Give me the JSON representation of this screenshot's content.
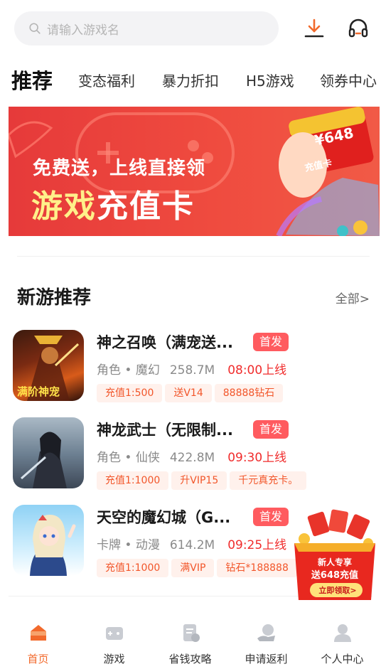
{
  "search": {
    "placeholder": "请输入游戏名",
    "icon": "search-icon"
  },
  "header_icons": {
    "download": "download-icon",
    "service": "headset-icon"
  },
  "tabs": [
    {
      "label": "推荐",
      "active": true
    },
    {
      "label": "变态福利"
    },
    {
      "label": "暴力折扣"
    },
    {
      "label": "H5游戏"
    },
    {
      "label": "领券中心"
    }
  ],
  "banner": {
    "line1": "免费送，上线直接领",
    "line2_a": "游戏",
    "line2_b": "充值卡",
    "card_amount": "¥648",
    "card_text": "充值卡"
  },
  "section": {
    "title": "新游推荐",
    "more": "全部>"
  },
  "games": [
    {
      "name": "神之召唤（满宠送...",
      "badge": "首发",
      "category": "角色 • 魔幻",
      "size": "258.7M",
      "time": "08:00上线",
      "tags": [
        "充值1:500",
        "送V14",
        "88888钻石"
      ],
      "thumb_text": "满阶神宠"
    },
    {
      "name": "神龙武士（无限制...",
      "badge": "首发",
      "category": "角色 • 仙侠",
      "size": "422.8M",
      "time": "09:30上线",
      "tags": [
        "充值1:1000",
        "升VIP15",
        "千元真充卡。"
      ]
    },
    {
      "name": "天空的魔幻城（G...",
      "badge": "首发",
      "category": "卡牌 • 动漫",
      "size": "614.2M",
      "time": "09:25上线",
      "tags": [
        "充值1:1000",
        "满VIP",
        "钻石*188888"
      ]
    }
  ],
  "promo": {
    "line1": "新人专享",
    "line2": "送648充值",
    "button": "立即领取>"
  },
  "nav": [
    {
      "label": "首页",
      "icon": "home-icon",
      "active": true
    },
    {
      "label": "游戏",
      "icon": "gamepad-icon"
    },
    {
      "label": "省钱攻略",
      "icon": "guide-icon"
    },
    {
      "label": "申请返利",
      "icon": "rebate-icon"
    },
    {
      "label": "个人中心",
      "icon": "user-icon"
    }
  ],
  "colors": {
    "accent": "#f26a2c",
    "badge": "#ff5b5f",
    "time": "#f02c2c",
    "tag_bg": "#fff1ec",
    "tag_text": "#f2562a",
    "banner": "#e63a3a"
  }
}
